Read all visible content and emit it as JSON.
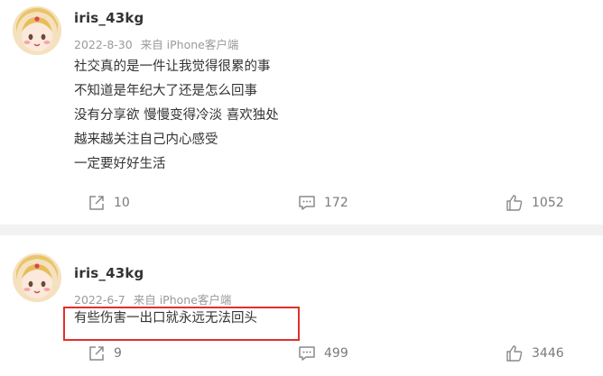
{
  "posts": [
    {
      "username": "iris_43kg",
      "date": "2022-8-30",
      "source": "来自 iPhone客户端",
      "lines": [
        "社交真的是一件让我觉得很累的事",
        "不知道是年纪大了还是怎么回事",
        "没有分享欲 慢慢变得冷淡 喜欢独处",
        "越来越关注自己内心感受",
        "一定要好好生活"
      ],
      "shares": "10",
      "comments": "172",
      "likes": "1052"
    },
    {
      "username": "iris_43kg",
      "date": "2022-6-7",
      "source": "来自 iPhone客户端",
      "lines": [
        "有些伤害一出口就永远无法回头"
      ],
      "shares": "9",
      "comments": "499",
      "likes": "3446"
    }
  ],
  "colors": {
    "highlight_border": "#e0302c",
    "text": "#333333",
    "meta": "#9a9a9a"
  },
  "icons": {
    "share": "share-icon",
    "comment": "comment-icon",
    "like": "thumbs-up-icon",
    "avatar": "anime-avatar"
  }
}
